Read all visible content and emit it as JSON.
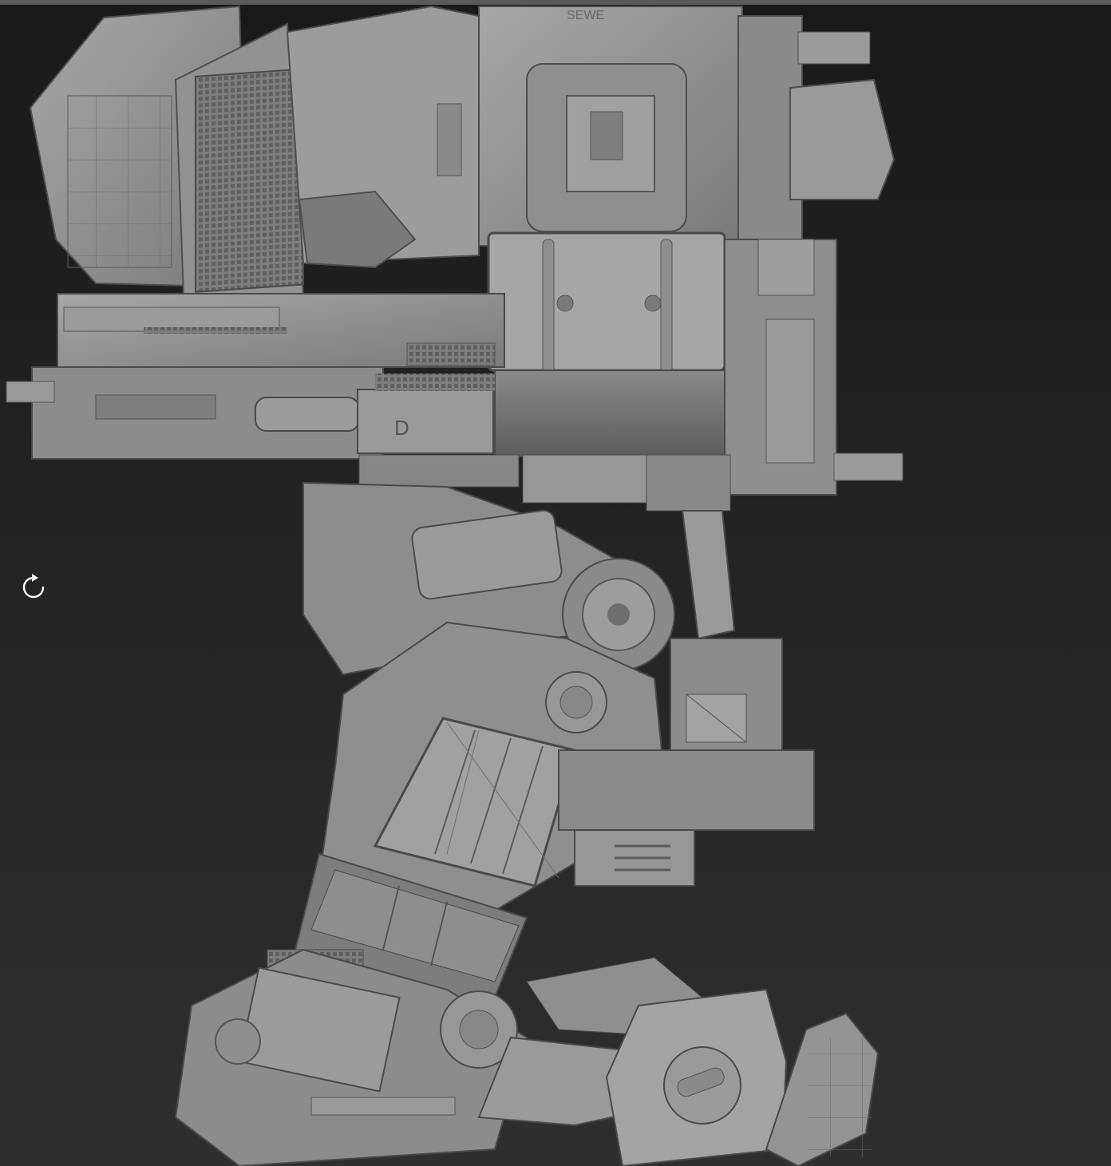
{
  "viewport": {
    "background_top": "#1a1a1a",
    "background_bottom": "#2f2f2f",
    "topbar_color": "#5a5a5a",
    "model_base_color": "#8c8c8c",
    "model_dark_color": "#5e5e5e",
    "model_light_color": "#b4b4b4"
  },
  "reset_view": {
    "icon": "rotate-clockwise-icon"
  },
  "model": {
    "hull_marking": "D",
    "top_marking": "SEWE"
  }
}
